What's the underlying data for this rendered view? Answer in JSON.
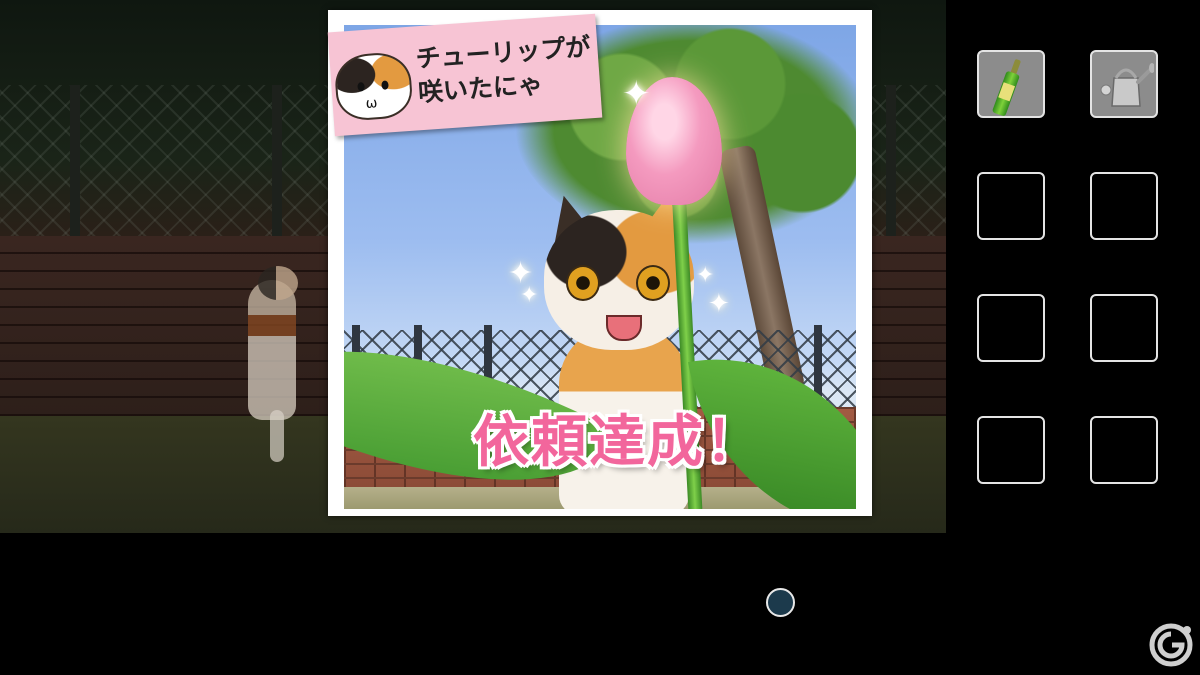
{
  "popup": {
    "speech": "チューリップが\n咲いたにゃ",
    "title": "依頼達成！"
  },
  "inventory": {
    "slots": [
      {
        "item": "spray-bottle-icon"
      },
      {
        "item": "watering-can-icon"
      },
      {
        "item": ""
      },
      {
        "item": ""
      },
      {
        "item": ""
      },
      {
        "item": ""
      },
      {
        "item": ""
      },
      {
        "item": ""
      }
    ]
  },
  "colors": {
    "title_pink": "#f2669c",
    "banner_pink": "#f7c4d4",
    "slot_border": "#e4e4e4",
    "cursor_fill": "#1c3a4c"
  }
}
